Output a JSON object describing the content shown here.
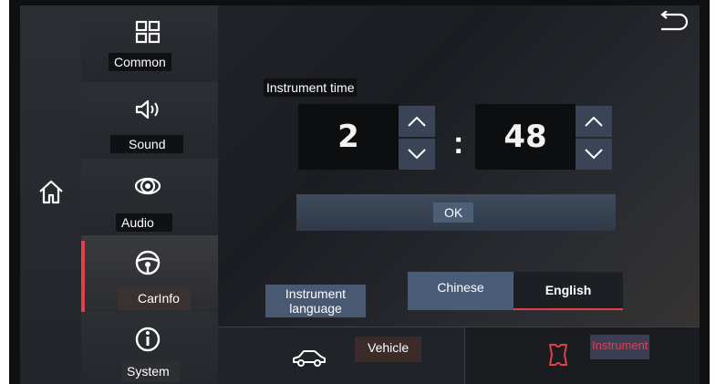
{
  "sidebar": {
    "items": [
      {
        "label": "Common",
        "icon": "grid-icon"
      },
      {
        "label": "Sound",
        "icon": "speaker-icon"
      },
      {
        "label": "Audio",
        "icon": "audio-icon"
      },
      {
        "label": "CarInfo",
        "icon": "steering-wheel-icon",
        "active": true
      },
      {
        "label": "System",
        "icon": "info-icon"
      }
    ],
    "home_icon": "home-icon"
  },
  "header": {
    "back_icon": "back-icon"
  },
  "instrument_time": {
    "label": "Instrument time",
    "hour": "2",
    "separator": ":",
    "minute": "48"
  },
  "ok_label": "OK",
  "language": {
    "label": "Instrument language",
    "options": [
      "Chinese",
      "English"
    ],
    "selected": "English"
  },
  "bottom_tabs": [
    {
      "label": "Vehicle",
      "icon": "car-icon"
    },
    {
      "label": "Instrument",
      "icon": "instrument-icon",
      "active": true
    }
  ],
  "colors": {
    "accent": "#e0404a",
    "button": "#3a4456"
  }
}
